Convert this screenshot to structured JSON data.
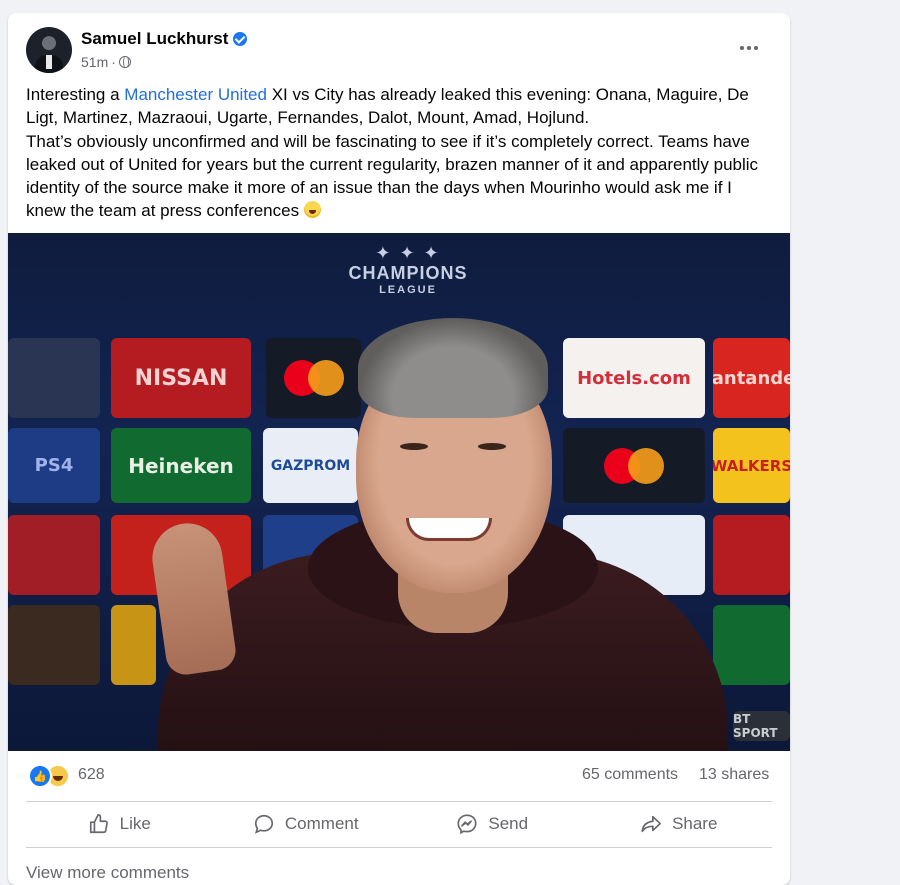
{
  "post": {
    "author": "Samuel Luckhurst",
    "verified": true,
    "timestamp": "51m",
    "separator": "·",
    "text_intro": "Interesting a ",
    "text_link": "Manchester United",
    "text_rest": " XI vs City has already leaked this evening: Onana, Maguire, De Ligt, Martinez, Mazraoui, Ugarte, Fernandes, Dalot, Mount, Amad, Hojlund.",
    "text_para2": "That’s obviously unconfirmed and will be fascinating to see if it’s completely correct. Teams have leaked out of United for years but the current regularity, brazen manner of it and apparently public identity of the source make it more of an issue than the days when Mourinho would ask me if I knew the team at press conferences "
  },
  "photo": {
    "logo_line1": "CHAMPIONS",
    "logo_line2": "LEAGUE",
    "sponsors": [
      "NISSAN",
      "Heineken",
      "GAZPROM",
      "Hotels.com",
      "Santander",
      "WALKERS",
      "PS4",
      "BT SPORT"
    ]
  },
  "stats": {
    "reaction_count": "628",
    "comments": "65 comments",
    "shares": "13 shares"
  },
  "actions": {
    "like": "Like",
    "comment": "Comment",
    "send": "Send",
    "share": "Share"
  },
  "footer": {
    "view_more": "View more comments"
  },
  "colors": {
    "link": "#216fdb",
    "verified": "#1877f2",
    "muted": "#65676b"
  }
}
